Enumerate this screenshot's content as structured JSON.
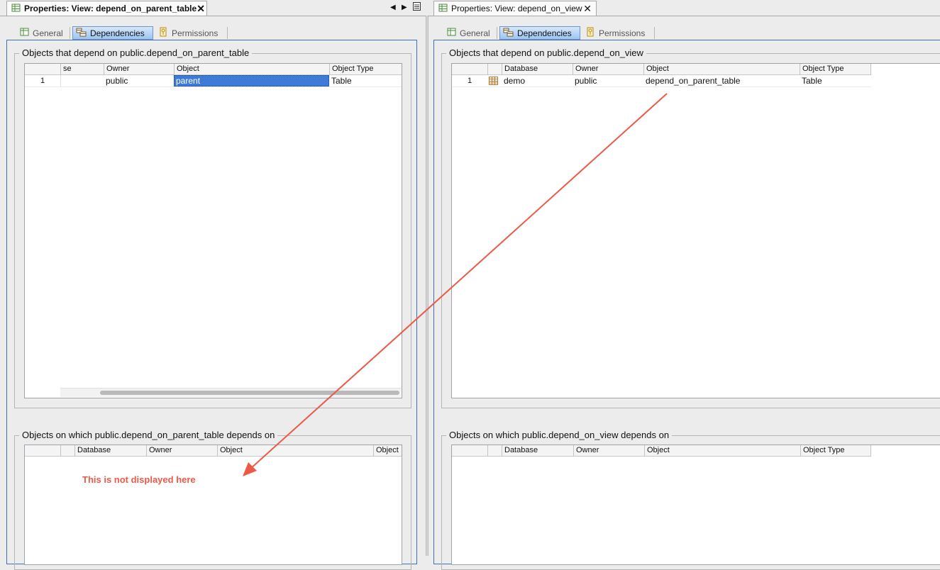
{
  "left": {
    "tab_title": "Properties: View: depend_on_parent_table",
    "subtabs": [
      "General",
      "Dependencies",
      "Permissions"
    ],
    "group1_title": "Objects that depend on public.depend_on_parent_table",
    "grid1": {
      "headers": [
        "se",
        "Owner",
        "Object",
        "Object Type"
      ],
      "row": {
        "num": "1",
        "db": "",
        "owner": "public",
        "object": "parent",
        "type": "Table"
      }
    },
    "group2_title": "Objects on which public.depend_on_parent_table depends on",
    "grid2": {
      "headers": [
        "Database",
        "Owner",
        "Object",
        "Object"
      ]
    },
    "annotation": "This is not displayed here"
  },
  "right": {
    "tab_title": "Properties: View: depend_on_view",
    "subtabs": [
      "General",
      "Dependencies",
      "Permissions"
    ],
    "group1_title": "Objects that depend on public.depend_on_view",
    "grid1": {
      "headers": [
        "Database",
        "Owner",
        "Object",
        "Object Type"
      ],
      "row": {
        "num": "1",
        "db": "demo",
        "owner": "public",
        "object": "depend_on_parent_table",
        "type": "Table"
      }
    },
    "group2_title": "Objects on which public.depend_on_view depends on",
    "grid2": {
      "headers": [
        "Database",
        "Owner",
        "Object",
        "Object Type"
      ]
    }
  },
  "colors": {
    "annotation": "#ec5a47",
    "selection": "#3d7bd6",
    "frame": "#3f70b6"
  }
}
